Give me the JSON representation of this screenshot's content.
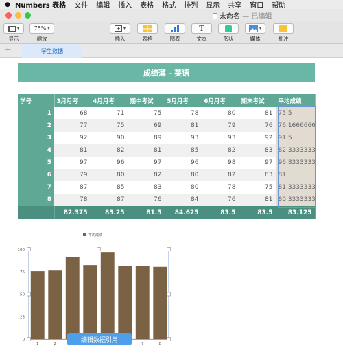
{
  "menubar": {
    "items": [
      "Numbers 表格",
      "文件",
      "编辑",
      "插入",
      "表格",
      "格式",
      "排列",
      "显示",
      "共享",
      "窗口",
      "帮助"
    ]
  },
  "window": {
    "title": "未命名",
    "edited": "— 已编辑",
    "traffic_colors": [
      "#fc605c",
      "#fdbc40",
      "#34c84a"
    ]
  },
  "toolbar": {
    "view_label": "显示",
    "zoom_value": "75%",
    "zoom_label": "缩放",
    "insert_label": "插入",
    "table_label": "表格",
    "chart_label": "图表",
    "text_label": "文本",
    "shape_label": "形状",
    "media_label": "媒体",
    "comment_label": "批注"
  },
  "tabs": {
    "add": "+",
    "sheet": "学生数据"
  },
  "sheet_title": "成绩薄 - 英语",
  "table": {
    "headers": [
      "学号",
      "3月月考",
      "4月月考",
      "期中考试",
      "5月月考",
      "6月月考",
      "期末考试",
      "平均成绩"
    ],
    "rows": [
      [
        "1",
        "68",
        "71",
        "75",
        "78",
        "80",
        "81",
        "75.5"
      ],
      [
        "2",
        "77",
        "75",
        "69",
        "81",
        "79",
        "76",
        "76.1666666"
      ],
      [
        "3",
        "92",
        "90",
        "89",
        "93",
        "93",
        "92",
        "91.5"
      ],
      [
        "4",
        "81",
        "82",
        "81",
        "85",
        "82",
        "83",
        "82.3333333"
      ],
      [
        "5",
        "97",
        "96",
        "97",
        "96",
        "98",
        "97",
        "96.8333333"
      ],
      [
        "6",
        "79",
        "80",
        "82",
        "80",
        "82",
        "83",
        "81"
      ],
      [
        "7",
        "87",
        "85",
        "83",
        "80",
        "78",
        "75",
        "81.3333333"
      ],
      [
        "8",
        "78",
        "87",
        "76",
        "84",
        "76",
        "81",
        "80.3333333"
      ]
    ],
    "footer": [
      "",
      "82.375",
      "83.25",
      "81.5",
      "84.625",
      "83.5",
      "83.5",
      "83.125"
    ]
  },
  "chart_data": {
    "type": "bar",
    "categories": [
      "1",
      "2",
      "3",
      "4",
      "5",
      "6",
      "7",
      "8"
    ],
    "series": [
      {
        "name": "平均成绩",
        "values": [
          75.5,
          76.17,
          91.5,
          82.33,
          96.83,
          81,
          81.33,
          80.33
        ],
        "color": "#7b6245"
      }
    ],
    "yticks": [
      "0",
      "25",
      "50",
      "75",
      "100"
    ],
    "ylim": [
      0,
      100
    ],
    "legend": "top",
    "grid": false
  },
  "edit_button": "编辑数据引用",
  "colors": {
    "accent": "#5fa895",
    "footer": "#4a8f7f",
    "selection": "#6a95d8",
    "bar": "#7b6245"
  }
}
